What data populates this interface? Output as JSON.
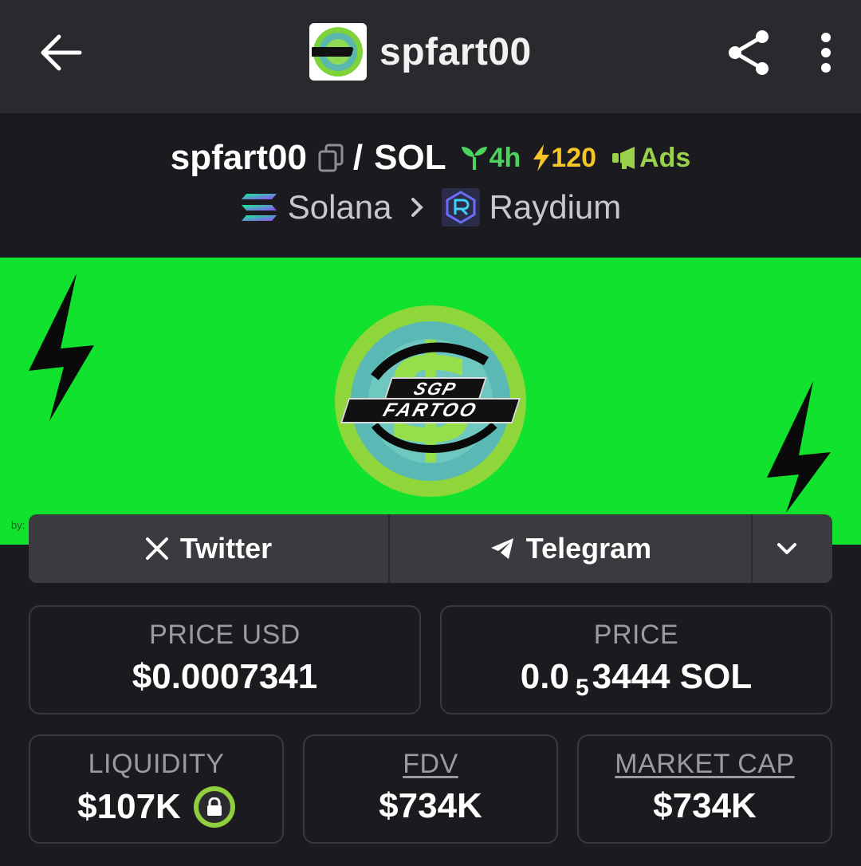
{
  "appbar": {
    "title": "spfart00",
    "back_icon": "arrow-left-icon",
    "share_icon": "share-icon",
    "more_icon": "more-vertical-icon"
  },
  "pair": {
    "base": "spfart00",
    "separator": "/",
    "quote": "SOL",
    "age": "4h",
    "boosts": "120",
    "ads_label": "Ads",
    "chain": "Solana",
    "dex": "Raydium"
  },
  "banner": {
    "logo_text_top": "SGP",
    "logo_text_bottom": "FARTOO",
    "credit": "by:"
  },
  "social": {
    "twitter": "Twitter",
    "telegram": "Telegram"
  },
  "stats": {
    "price_usd_label": "PRICE USD",
    "price_usd_value": "$0.0007341",
    "price_label": "PRICE",
    "price_prefix": "0.0",
    "price_subscript": "5",
    "price_suffix": "3444 SOL",
    "liquidity_label": "LIQUIDITY",
    "liquidity_value": "$107K",
    "fdv_label": "FDV",
    "fdv_value": "$734K",
    "mcap_label": "MARKET CAP",
    "mcap_value": "$734K"
  },
  "colors": {
    "age_green": "#4cd35e",
    "boost_yellow": "#f6c626",
    "ads_green": "#9ad04a",
    "banner_green": "#10e22e",
    "lock_green": "#8fce3e"
  }
}
